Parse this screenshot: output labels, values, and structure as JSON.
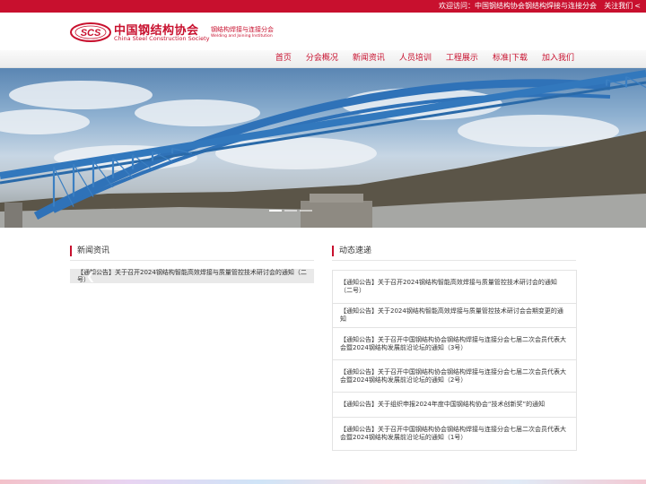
{
  "topbar": {
    "welcome": "欢迎访问：中国钢结构协会钢结构焊接与连接分会",
    "follow": "关注我们",
    "share_icon": "share-icon"
  },
  "logo": {
    "badge": "SCS",
    "name_cn": "中国钢结构协会",
    "name_en": "China Steel Construction Society",
    "sub_cn": "钢结构焊接与连接分会",
    "sub_en": "Welding and Joining Institution"
  },
  "nav": {
    "items": [
      {
        "label": "首页"
      },
      {
        "label": "分会概况"
      },
      {
        "label": "新闻资讯"
      },
      {
        "label": "人员培训"
      },
      {
        "label": "工程展示"
      },
      {
        "label": "标准|下载"
      },
      {
        "label": "加入我们"
      }
    ]
  },
  "banner": {
    "slide_count": 3,
    "active_slide": 1
  },
  "news": {
    "title": "新闻资讯",
    "slide_text": "【通知公告】关于召开2024钢结构智能高效焊接与质量管控技术研讨会的通知（二号）",
    "prev_icon": "chevron-left-icon",
    "next_icon": "chevron-right-icon"
  },
  "dynamics": {
    "title": "动态速递",
    "items": [
      {
        "text": "【通知公告】关于召开2024钢结构智能高效焊接与质量管控技术研讨会的通知（二号）"
      },
      {
        "text": "【通知公告】关于2024钢结构智能高效焊接与质量管控技术研讨会会期变更的通知"
      },
      {
        "text": "【通知公告】关于召开中国钢结构协会钢结构焊接与连接分会七届二次会员代表大会暨2024钢结构发展前沿论坛的通知（3号）"
      },
      {
        "text": "【通知公告】关于召开中国钢结构协会钢结构焊接与连接分会七届二次会员代表大会暨2024钢结构发展前沿论坛的通知（2号）"
      },
      {
        "text": "【通知公告】关于组织申报2024年度中国钢结构协会“技术创新奖”的通知"
      },
      {
        "text": "【通知公告】关于召开中国钢结构协会钢结构焊接与连接分会七届二次会员代表大会暨2024钢结构发展前沿论坛的通知（1号）"
      }
    ]
  },
  "colors": {
    "brand": "#c8102e",
    "bridge": "#2f72b8"
  }
}
